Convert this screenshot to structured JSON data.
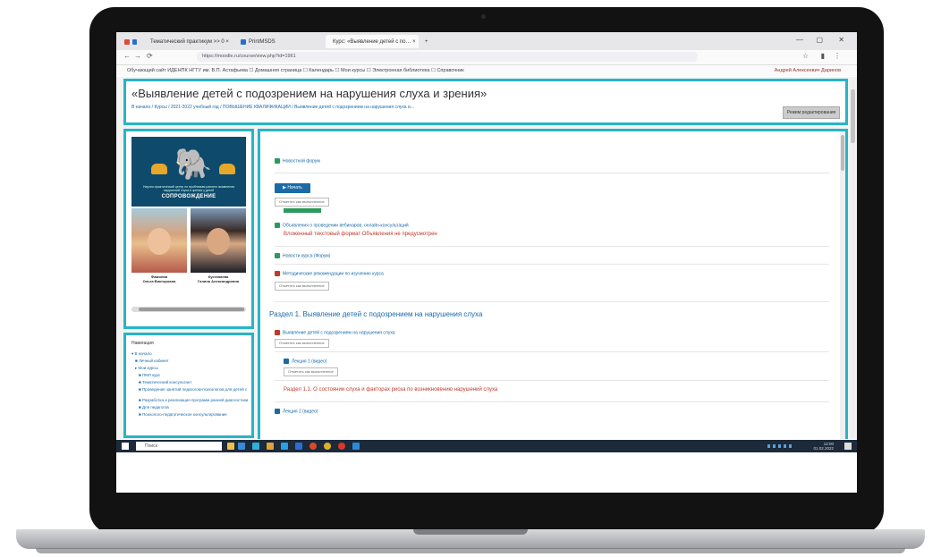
{
  "browser": {
    "tabs": [
      {
        "label": "Тематический практикум >> 0 ×",
        "icon_color": "#e08a2a"
      },
      {
        "label": "PrintMSDS",
        "icon_color": "#2a6fd0"
      },
      {
        "label": "Курс: «Выявление детей с по… ×",
        "icon_color": "#1a6aa8"
      }
    ],
    "new_tab": "+",
    "window_controls": [
      "—",
      "▢",
      "✕"
    ],
    "url": "https://moodle.ru/course/view.php?id=1961",
    "nav": [
      "←",
      "→",
      "⟳"
    ],
    "right_icons": [
      "☆",
      "▮",
      "⋮"
    ],
    "bookmarks": "Обучающий сайт ИДЕНПК НГТУ им. В.П. Астафьева   ☐ Домашняя страница   ☐ Календарь   ☐ Мои курсы   ☐ Электронная библиотека   ☐ Справочник",
    "user_link": "Андрей Алексеевич Даринов"
  },
  "course": {
    "title": "«Выявление детей с подозрением на нарушения слуха и зрения»",
    "breadcrumb": "В начало  /  Курсы  /  2021-2022 учебный год  /  ПОВЫШЕНИЕ КВАЛИФИКАЦИИ  /  Выявление детей с подозрением на нарушения слуха и...",
    "edit_button": "Режим редактирования"
  },
  "banner": {
    "subtitle": "Научно-практический центр по проблемам раннего выявления нарушений слуха и зрения у детей",
    "brand": "СОПРОВОЖДЕНИЕ"
  },
  "instructors": [
    {
      "name": "Фамилия\nОльга Викторовна"
    },
    {
      "name": "Кустанаева\nГалина Александровна"
    }
  ],
  "navigation": {
    "title": "Навигация",
    "items": [
      "▾ В начало",
      "■ Личный кабинет",
      "▸ Мои курсы",
      "■ ПМЛ курс",
      "■ Тематический консультант",
      "■ Проведение занятий педагогом-психологом для детей с",
      "■ Разработка и реализация программ ранней диагностики",
      "■ Для педагогов",
      "■ Психолого-педагогическое консультирование"
    ]
  },
  "content": {
    "activities": [
      {
        "label": "Новостной форум",
        "icon_color": "#2b9a5c"
      },
      {
        "label": "Объявления о проведении вебинаров, онлайн-консультаций",
        "icon_color": "#2b9a5c"
      },
      {
        "label": "Новости курса (Форум)",
        "icon_color": "#2b9a5c"
      },
      {
        "label": "Методические рекомендации по изучению курса",
        "icon_color": "#c0392b"
      }
    ],
    "blue_button": "▶ Начать",
    "mark_done_1": "Отметить как выполненное",
    "mark_done_2": "Отметить как выполненное",
    "red_note_1": "Вложенный текстовый формат Объявления не предусмотрен",
    "section_title": "Раздел 1. Выявление детей с подозрением на нарушения слуха",
    "section_items": [
      {
        "label": "Выявление детей с подозрением на нарушения слуха",
        "icon_color": "#c0392b"
      },
      {
        "label": "Лекция 1 (видео)",
        "icon_color": "#1a6aa8"
      },
      {
        "label": "Лекция 2 (видео)",
        "icon_color": "#1a6aa8"
      }
    ],
    "mark_done_3": "Отметить как выполненное",
    "mark_done_4": "Отметить как выполненное",
    "red_note_2": "Раздел 1.1. О состоянии слуха и факторах риска по возникновению нарушений слуха"
  },
  "taskbar": {
    "search": "Поиск",
    "time": "12:00",
    "date": "01.02.2022",
    "icon_colors": [
      "#f0c04a",
      "#3a8ad8",
      "#2fb0d8",
      "#e0a33a",
      "#2ba0e0",
      "#2a6fd0",
      "#d84a2a",
      "#e0b02a",
      "#d8382a",
      "#2a8ad8"
    ]
  }
}
